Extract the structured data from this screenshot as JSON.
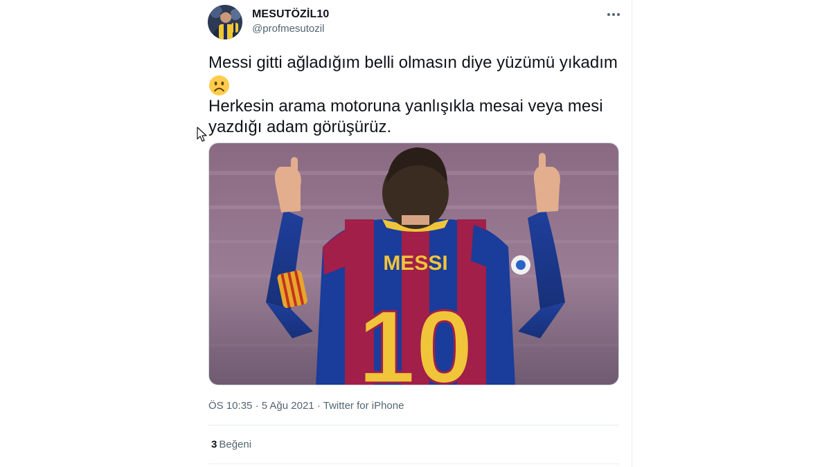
{
  "tweet": {
    "display_name": "MESUTÖZİL10",
    "handle": "@profmesutozil",
    "more_icon": "more-horizontal-icon",
    "text_lines": [
      "Messi gitti ağladığım belli olmasın diye yüzümü yıkadım",
      "Herkesin arama motoruna yanlışıkla mesai veya mesi",
      "yazdığı adam görüşürüz."
    ],
    "emoji": "sad-face-emoji",
    "media": {
      "jersey_name": "MESSI",
      "jersey_number": "10"
    },
    "time": "ÖS 10:35",
    "date": "5 Ağu 2021",
    "source": "Twitter for iPhone",
    "separator": "·",
    "like_count": "3",
    "like_label": "Beğeni"
  },
  "colors": {
    "text_primary": "#0f1419",
    "text_secondary": "#536471",
    "divider": "#e6ecf0",
    "emoji_face": "#ffcc4d"
  }
}
